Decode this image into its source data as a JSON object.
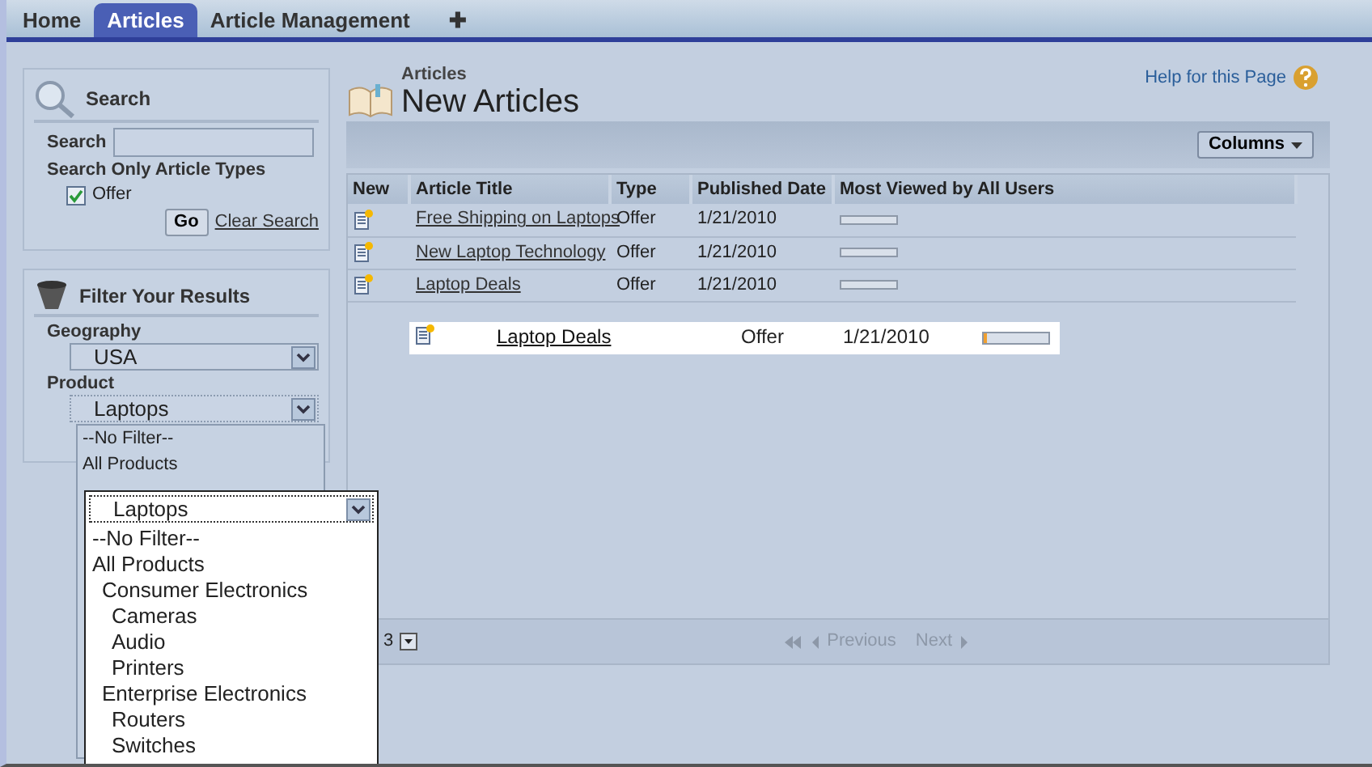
{
  "tabs": [
    {
      "label": "Home",
      "selected": false
    },
    {
      "label": "Articles",
      "selected": true
    },
    {
      "label": "Article Management",
      "selected": false
    },
    {
      "label": "✚",
      "selected": false
    }
  ],
  "search_panel": {
    "title": "Search",
    "search_label": "Search",
    "types_label": "Search Only Article Types",
    "types": [
      {
        "label": "Offer",
        "checked": true
      }
    ],
    "go_button": "Go",
    "clear_link": "Clear Search"
  },
  "filter_panel": {
    "title": "Filter Your Results",
    "geography_label": "Geography",
    "geography_value": "USA",
    "product_label": "Product",
    "product_value": "Laptops",
    "product_options": [
      "--No Filter--",
      "All Products"
    ]
  },
  "product_dropdown": {
    "value": "Laptops",
    "options": [
      {
        "label": "--No Filter--"
      },
      {
        "label": "All Products",
        "children": [
          {
            "label": "Consumer Electronics",
            "children": [
              {
                "label": "Cameras"
              },
              {
                "label": "Audio"
              },
              {
                "label": "Printers"
              }
            ]
          },
          {
            "label": "Enterprise Electronics",
            "children": [
              {
                "label": "Routers"
              },
              {
                "label": "Switches"
              }
            ]
          }
        ]
      }
    ]
  },
  "header": {
    "breadcrumb": "Articles",
    "title": "New Articles",
    "help_link": "Help for this Page"
  },
  "toolbar": {
    "columns_button": "Columns"
  },
  "table": {
    "columns": [
      "New",
      "Article Title",
      "Type",
      "Published Date",
      "Most Viewed by All Users"
    ],
    "rows": [
      {
        "title": "Free Shipping on Laptops",
        "type": "Offer",
        "date": "1/21/2010",
        "level": 0
      },
      {
        "title": "New Laptop Technology",
        "type": "Offer",
        "date": "1/21/2010",
        "level": 0
      },
      {
        "title": "Laptop Deals",
        "type": "Offer",
        "date": "1/21/2010",
        "level": 0
      }
    ]
  },
  "dragged_row": {
    "title": "Laptop Deals",
    "type": "Offer",
    "date": "1/21/2010",
    "level": 0.04
  },
  "pagination": {
    "page_size": "3",
    "previous": "Previous",
    "next": "Next",
    "disabled": true
  }
}
